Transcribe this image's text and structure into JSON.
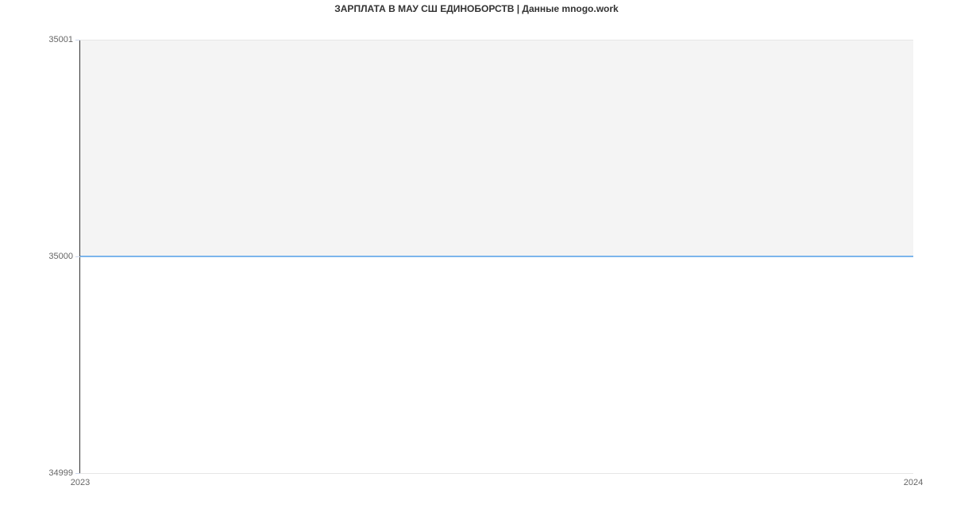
{
  "chart_data": {
    "type": "line",
    "title": "ЗАРПЛАТА В МАУ СШ ЕДИНОБОРСТВ | Данные mnogo.work",
    "xlabel": "",
    "ylabel": "",
    "x_ticks": [
      "2023",
      "2024"
    ],
    "y_ticks": [
      34999,
      35000,
      35001
    ],
    "ylim": [
      34999,
      35001
    ],
    "x": [
      2023,
      2024
    ],
    "values": [
      35000,
      35000
    ],
    "series_color": "#7cb5ec"
  }
}
